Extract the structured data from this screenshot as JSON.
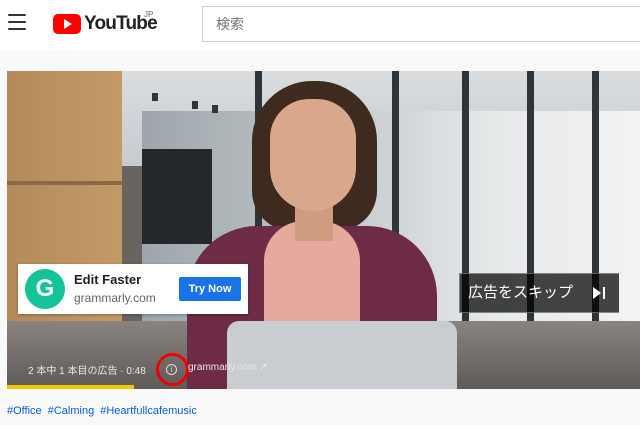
{
  "header": {
    "logo_text": "YouTube",
    "region": "JP",
    "search_placeholder": "検索"
  },
  "ad": {
    "card_title": "Edit Faster",
    "card_domain": "grammarly.com",
    "card_logo_letter": "G",
    "card_cta": "Try Now",
    "skip_label": "広告をスキップ",
    "info_text": "2 本中 1 本目の広告 · 0:48",
    "info_link": "grammarly.com",
    "progress_fraction": 0.2
  },
  "video_meta": {
    "hashtags": [
      "#Office",
      "#Calming",
      "#Heartfullcafemusic"
    ]
  },
  "colors": {
    "brand_red": "#ff0000",
    "cta_blue": "#1a73e8",
    "ad_progress": "#f2c500",
    "grammarly_green": "#15c39a",
    "highlight_circle": "#ee0000"
  }
}
